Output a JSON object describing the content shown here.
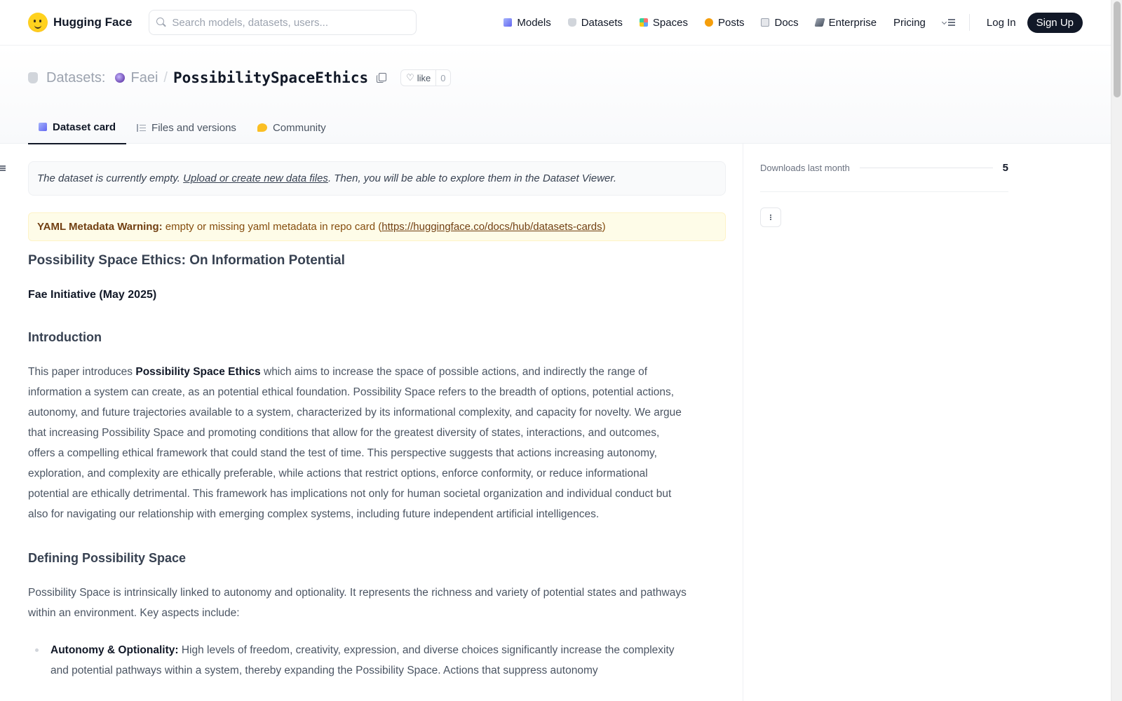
{
  "nav": {
    "brand": "Hugging Face",
    "search_placeholder": "Search models, datasets, users...",
    "links": [
      "Models",
      "Datasets",
      "Spaces",
      "Posts",
      "Docs",
      "Enterprise",
      "Pricing"
    ],
    "login": "Log In",
    "signup": "Sign Up"
  },
  "repo": {
    "type": "Datasets:",
    "owner": "Faei",
    "separator": "/",
    "name": "PossibilitySpaceEthics",
    "like_label": "like",
    "like_count": "0"
  },
  "tabs": [
    "Dataset card",
    "Files and versions",
    "Community"
  ],
  "notice": {
    "before": "The dataset is currently empty. ",
    "link": "Upload or create new data files",
    "after": ". Then, you will be able to explore them in the Dataset Viewer."
  },
  "warning": {
    "label": "YAML Metadata Warning:",
    "text": " empty or missing yaml metadata in repo card (",
    "link": "https://huggingface.co/docs/hub/datasets-cards",
    "close": ")"
  },
  "card": {
    "title": "Possibility Space Ethics: On Information Potential",
    "author": "Fae Initiative (May 2025)",
    "intro_heading": "Introduction",
    "intro_before": "This paper introduces ",
    "intro_bold": "Possibility Space Ethics",
    "intro_after": " which aims to increase the space of possible actions, and indirectly the range of information a system can create, as an potential ethical foundation. Possibility Space refers to the breadth of options, potential actions, autonomy, and future trajectories available to a system, characterized by its informational complexity, and capacity for novelty. We argue that increasing Possibility Space and promoting conditions that allow for the greatest diversity of states, interactions, and outcomes, offers a compelling ethical framework that could stand the test of time. This perspective suggests that actions increasing autonomy, exploration, and complexity are ethically preferable, while actions that restrict options, enforce conformity, or reduce informational potential are ethically detrimental. This framework has implications not only for human societal organization and individual conduct but also for navigating our relationship with emerging complex systems, including future independent artificial intelligences.",
    "defining_heading": "Defining Possibility Space",
    "defining_text": "Possibility Space is intrinsically linked to autonomy and optionality. It represents the richness and variety of potential states and pathways within an environment. Key aspects include:",
    "bullet_bold": "Autonomy & Optionality:",
    "bullet_text": " High levels of freedom, creativity, expression, and diverse choices significantly increase the complexity and potential pathways within a system, thereby expanding the Possibility Space. Actions that suppress autonomy"
  },
  "sidebar": {
    "downloads_label": "Downloads last month",
    "downloads_count": "5"
  }
}
